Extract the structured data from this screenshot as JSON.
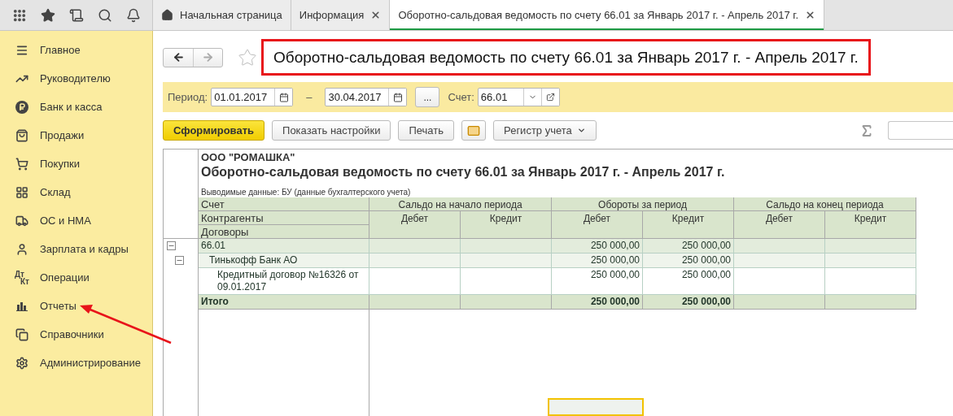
{
  "tabs": [
    {
      "label": "Начальная страница",
      "kind": "home",
      "selected": false,
      "closable": false
    },
    {
      "label": "Информация",
      "kind": "page",
      "selected": false,
      "closable": true
    },
    {
      "label": "Оборотно-сальдовая ведомость по счету 66.01 за Январь 2017 г. - Апрель 2017 г.",
      "kind": "page",
      "selected": true,
      "closable": true
    }
  ],
  "sidebar": {
    "items": [
      {
        "label": "Главное"
      },
      {
        "label": "Руководителю"
      },
      {
        "label": "Банк и касса"
      },
      {
        "label": "Продажи"
      },
      {
        "label": "Покупки"
      },
      {
        "label": "Склад"
      },
      {
        "label": "ОС и НМА"
      },
      {
        "label": "Зарплата и кадры"
      },
      {
        "label": "Операции",
        "icon_text": [
          "Дт",
          "Кт"
        ]
      },
      {
        "label": "Отчеты"
      },
      {
        "label": "Справочники"
      },
      {
        "label": "Администрирование"
      }
    ]
  },
  "form": {
    "title": "Оборотно-сальдовая ведомость по счету 66.01 за Январь 2017 г. - Апрель 2017 г.",
    "favorite": false
  },
  "filters": {
    "period_label": "Период:",
    "date_from": "01.01.2017",
    "dash": "–",
    "date_to": "30.04.2017",
    "more": "...",
    "account_label": "Счет:",
    "account": "66.01"
  },
  "actions": [
    {
      "label": "Сформировать",
      "kind": "primary"
    },
    {
      "label": "Показать настройки",
      "kind": "plain"
    },
    {
      "label": "Печать",
      "kind": "plain"
    },
    {
      "kind": "mail"
    },
    {
      "label": "Регистр учета",
      "kind": "dropdown"
    }
  ],
  "report": {
    "company": "ООО \"РОМАШКА\"",
    "title": "Оборотно-сальдовая ведомость по счету 66.01 за Январь 2017 г. - Апрель 2017 г.",
    "output_data": "Выводимые данные:  БУ (данные бухгалтерского учета)",
    "row_headers": [
      "Счет",
      "Контрагенты",
      "Договоры"
    ],
    "column_groups": [
      {
        "label": "Сальдо на начало периода",
        "columns": [
          "Дебет",
          "Кредит"
        ]
      },
      {
        "label": "Обороты за период",
        "columns": [
          "Дебет",
          "Кредит"
        ]
      },
      {
        "label": "Сальдо на конец периода",
        "columns": [
          "Дебет",
          "Кредит"
        ]
      }
    ],
    "rows": [
      {
        "label": "66.01",
        "expanded": true,
        "turnover": {
          "debit": "250 000,00",
          "credit": "250 000,00"
        },
        "children": [
          {
            "label": "Тинькофф Банк АО",
            "expanded": true,
            "turnover": {
              "debit": "250 000,00",
              "credit": "250 000,00"
            },
            "children": [
              {
                "label": "Кредитный договор №16326 от 09.01.2017",
                "turnover": {
                  "debit": "250 000,00",
                  "credit": "250 000,00"
                }
              }
            ]
          }
        ]
      }
    ],
    "total": {
      "label": "Итого",
      "turnover": {
        "debit": "250 000,00",
        "credit": "250 000,00"
      }
    }
  }
}
